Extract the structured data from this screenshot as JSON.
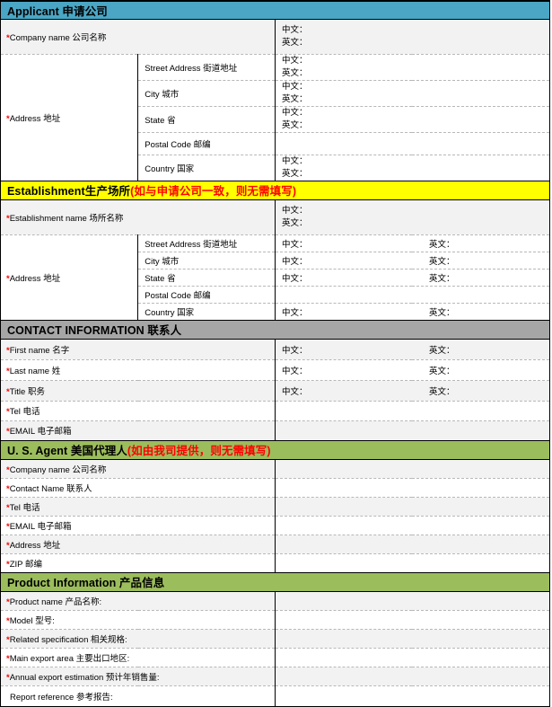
{
  "colors": {
    "applicant_header_bg": "#4aa6c4",
    "establishment_header_bg": "#ffff00",
    "contact_header_bg": "#a6a6a6",
    "agent_header_bg": "#9cbd5c",
    "product_header_bg": "#9cbd5c",
    "required_star": "#ff0000",
    "note_text": "#ff0000",
    "shaded_row": "#f2f2f2",
    "border": "#000000"
  },
  "common": {
    "chinese_label": "中文：",
    "english_label": "英文：",
    "star": "*"
  },
  "sections": {
    "applicant": {
      "header_en": "Applicant ",
      "header_cn": "申请公司",
      "rows": {
        "company_name": {
          "label_en": "Company name ",
          "label_cn": "公司名称",
          "cn": "中文：",
          "en": "英文："
        },
        "address_label_en": "Address ",
        "address_label_cn": "地址",
        "address_rows": [
          {
            "sub_en": "Street Address ",
            "sub_cn": "街道地址",
            "cn": "中文：",
            "en": "英文："
          },
          {
            "sub_en": "City ",
            "sub_cn": "城市",
            "cn": "中文：",
            "en": "英文："
          },
          {
            "sub_en": "State ",
            "sub_cn": "省",
            "cn": "中文：",
            "en": "英文："
          },
          {
            "sub_en": "Postal Code ",
            "sub_cn": "邮编",
            "cn": "",
            "en": ""
          },
          {
            "sub_en": "Country ",
            "sub_cn": "国家",
            "cn": "中文：",
            "en": "英文："
          }
        ]
      }
    },
    "establishment": {
      "header_en": "Establishment",
      "header_cn": "生产场所",
      "header_note": "(如与申请公司一致，则无需填写)",
      "rows": {
        "establishment_name": {
          "label_en": "Establishment name ",
          "label_cn": "场所名称",
          "cn": "中文：",
          "en": "英文："
        },
        "address_label_en": "Address ",
        "address_label_cn": "地址",
        "address_rows": [
          {
            "sub_en": "Street Address ",
            "sub_cn": "街道地址",
            "cn": "中文：",
            "en": "英文："
          },
          {
            "sub_en": "City ",
            "sub_cn": "城市",
            "cn": "中文：",
            "en": "英文："
          },
          {
            "sub_en": "State ",
            "sub_cn": "省",
            "cn": "中文：",
            "en": "英文："
          },
          {
            "sub_en": "Postal Code ",
            "sub_cn": "邮编",
            "cn": "",
            "en": ""
          },
          {
            "sub_en": "Country ",
            "sub_cn": "国家",
            "cn": "中文：",
            "en": "英文："
          }
        ]
      }
    },
    "contact": {
      "header_en": "CONTACT INFORMATION ",
      "header_cn": "联系人",
      "rows": [
        {
          "label_en": "First name ",
          "label_cn": "名字",
          "cn": "中文：",
          "en": "英文："
        },
        {
          "label_en": "Last name ",
          "label_cn": "姓",
          "cn": "中文：",
          "en": "英文："
        },
        {
          "label_en": "Title ",
          "label_cn": "职务",
          "cn": "中文：",
          "en": "英文："
        },
        {
          "label_en": "Tel ",
          "label_cn": "电话",
          "cn": "",
          "en": ""
        },
        {
          "label_en": "EMAIL ",
          "label_cn": "电子邮箱",
          "cn": "",
          "en": ""
        }
      ]
    },
    "agent": {
      "header_en": "U. S. Agent ",
      "header_cn": "美国代理人",
      "header_note": "(如由我司提供，则无需填写)",
      "rows": [
        {
          "label_en": "Company name ",
          "label_cn": "公司名称",
          "value": ""
        },
        {
          "label_en": "Contact Name ",
          "label_cn": "联系人",
          "value": ""
        },
        {
          "label_en": "Tel ",
          "label_cn": "电话",
          "value": ""
        },
        {
          "label_en": "EMAIL ",
          "label_cn": "电子邮箱",
          "value": ""
        },
        {
          "label_en": "Address ",
          "label_cn": "地址",
          "value": ""
        },
        {
          "label_en": "ZIP ",
          "label_cn": "邮编",
          "value": ""
        }
      ]
    },
    "product": {
      "header_en": "Product Information  ",
      "header_cn": "产品信息",
      "rows": [
        {
          "required": true,
          "label_en": "Product name ",
          "label_cn": "产品名称:",
          "value": ""
        },
        {
          "required": true,
          "label_en": "Model ",
          "label_cn": "型号:",
          "value": ""
        },
        {
          "required": true,
          "label_en": "Related specification ",
          "label_cn": "相关规格:",
          "value": ""
        },
        {
          "required": true,
          "label_en": "Main export area ",
          "label_cn": "主要出口地区:",
          "value": ""
        },
        {
          "required": true,
          "label_en": "Annual export estimation ",
          "label_cn": "预计年销售量:",
          "value": ""
        },
        {
          "required": false,
          "label_en": "Report reference ",
          "label_cn": "参考报告:",
          "value": ""
        }
      ]
    }
  }
}
